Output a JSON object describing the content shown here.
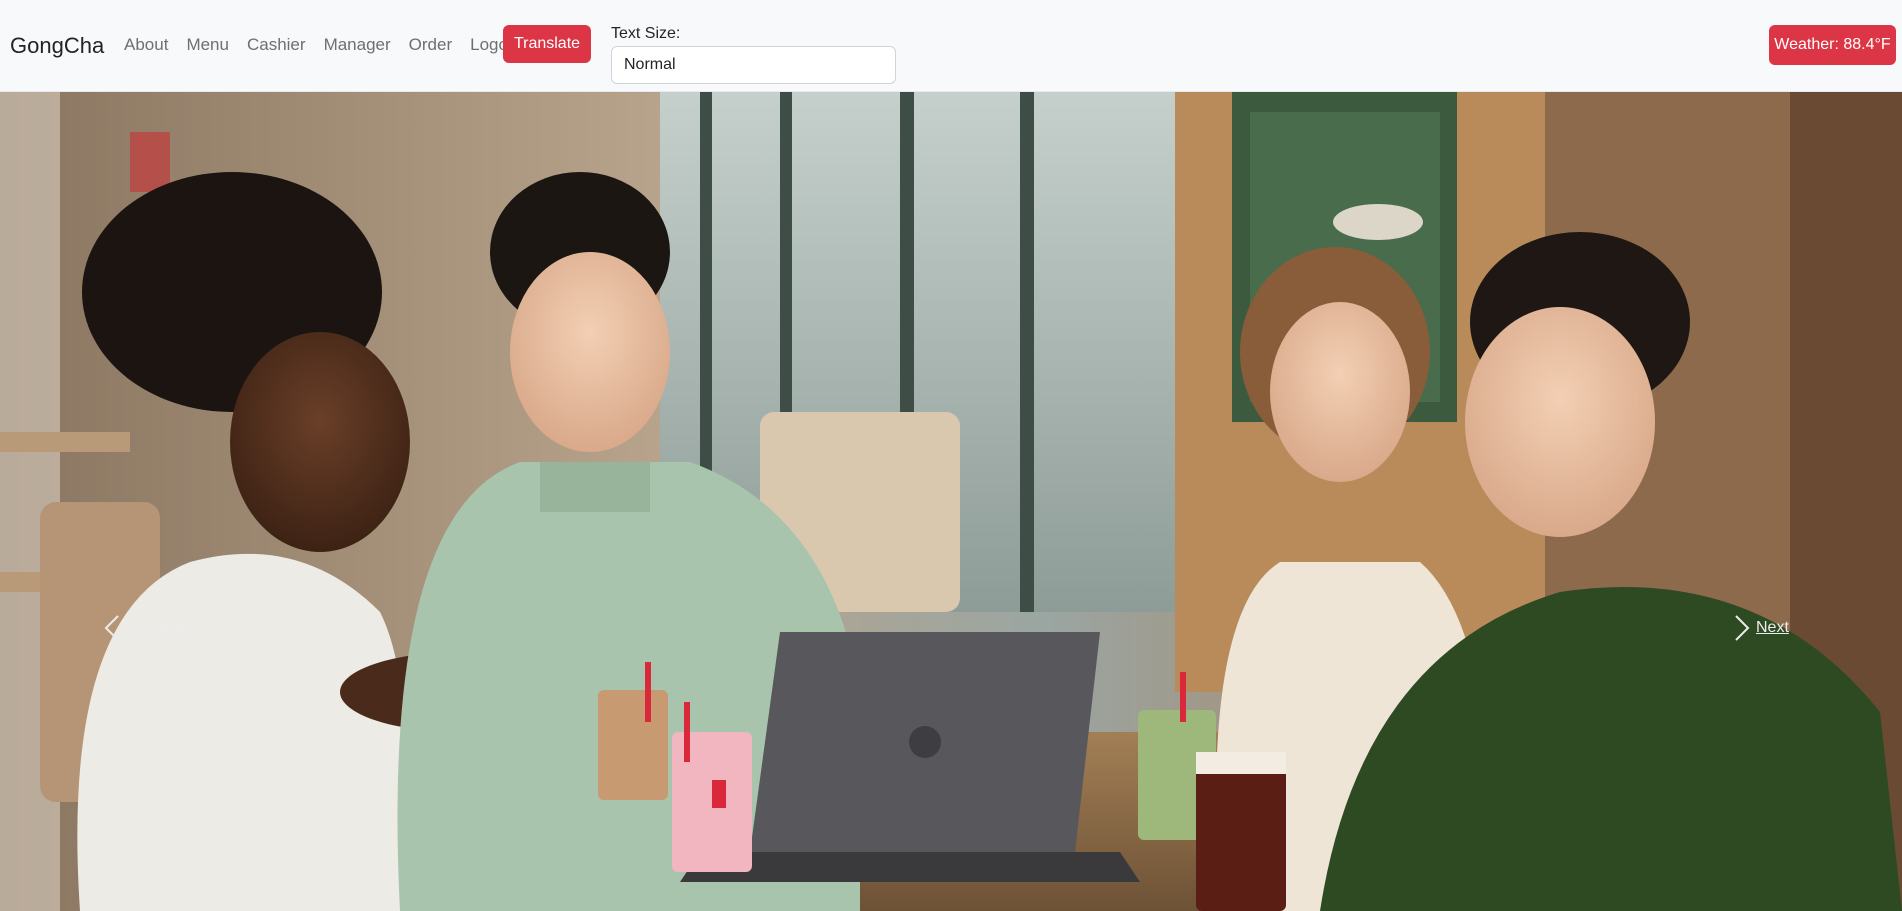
{
  "navbar": {
    "brand": "GongCha",
    "links": [
      {
        "id": "about",
        "label": "About"
      },
      {
        "id": "menu",
        "label": "Menu"
      },
      {
        "id": "cashier",
        "label": "Cashier"
      },
      {
        "id": "manager",
        "label": "Manager"
      },
      {
        "id": "order",
        "label": "Order"
      },
      {
        "id": "logout",
        "label": "Logout"
      }
    ],
    "translate_label": "Translate",
    "text_size": {
      "label": "Text Size:",
      "selected": "Normal"
    },
    "weather_label": "Weather: 88.4°F"
  },
  "carousel": {
    "prev_label": "Previous",
    "next_label": "Next",
    "prev_icon": "chevron-left-icon",
    "next_icon": "chevron-right-icon"
  },
  "colors": {
    "accent_red": "#dc3545",
    "navbar_bg": "#f8f9fa",
    "link_gray": "#6c6f73"
  }
}
